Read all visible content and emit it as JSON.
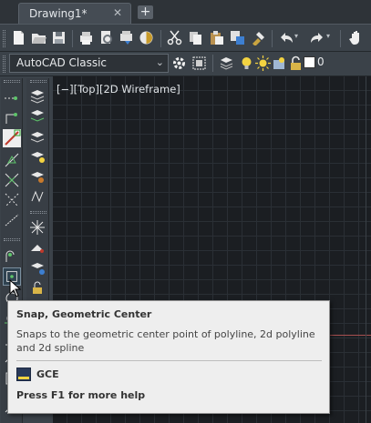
{
  "tabs": [
    {
      "title": "Drawing1*",
      "close_glyph": "✕"
    }
  ],
  "new_tab_glyph": "+",
  "workspace": {
    "selected": "AutoCAD Classic",
    "dropdown_icon": "chevron-down-icon"
  },
  "layer": {
    "current": "0"
  },
  "viewport": {
    "label": "[−][Top][2D Wireframe]"
  },
  "tooltip": {
    "title": "Snap, Geometric Center",
    "description": "Snaps to the geometric center point of polyline, 2d polyline and 2d spline",
    "command": "GCE",
    "help": "Press F1 for more help"
  },
  "colors": {
    "canvas_bg": "#1b1e22",
    "ui_bg": "#3b4249",
    "tooltip_bg": "#eeeeee",
    "accent_red": "#c0392b"
  }
}
